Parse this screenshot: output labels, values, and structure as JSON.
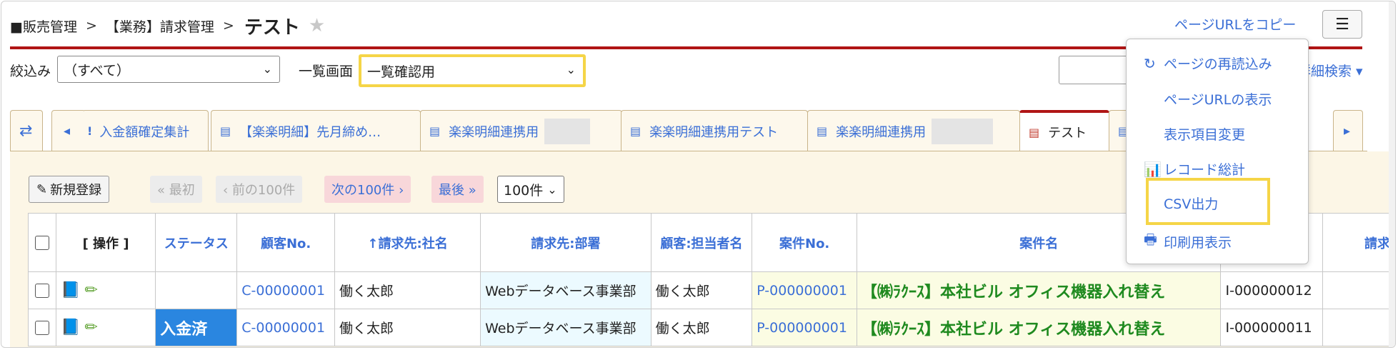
{
  "breadcrumb": {
    "root": "■販売管理",
    "sep": ">",
    "parent": "【業務】請求管理",
    "current": "テスト"
  },
  "header": {
    "copy_url": "ページURLをコピー"
  },
  "filter": {
    "label": "絞込み",
    "value": "（すべて）"
  },
  "listview": {
    "label": "一覧画面",
    "value": "一覧確認用"
  },
  "adv_search": "詳細検索 ▾",
  "tabs": [
    {
      "label": "入金額確定集計"
    },
    {
      "label": "【楽楽明細】先月締め…"
    },
    {
      "label": "楽楽明細連携用"
    },
    {
      "label": "楽楽明細連携用テスト"
    },
    {
      "label": "楽楽明細連携用"
    },
    {
      "label": "テスト"
    }
  ],
  "toolbar": {
    "new": "新規登録",
    "first": "« 最初",
    "prev": "‹ 前の100件",
    "next": "次の100件 ›",
    "last": "最後 »",
    "per_page": "100件"
  },
  "table": {
    "headers": {
      "op": "[ 操作 ]",
      "status": "ステータス",
      "customer_no": "顧客No.",
      "company": "↑請求先:社名",
      "dept": "請求先:部署",
      "contact": "顧客:担当者名",
      "case_no": "案件No.",
      "case_name": "案件名",
      "inv": "",
      "last": "請求"
    },
    "rows": [
      {
        "status": "",
        "customer_no": "C-00000001",
        "company": "働く太郎",
        "dept": "Webデータベース事業部",
        "contact": "働く太郎",
        "case_no": "P-000000001",
        "case_name": "【㈱ﾗｸｰｽ】本社ビル オフィス機器入れ替え",
        "inv": "I-000000012"
      },
      {
        "status": "入金済",
        "customer_no": "C-00000001",
        "company": "働く太郎",
        "dept": "Webデータベース事業部",
        "contact": "働く太郎",
        "case_no": "P-000000001",
        "case_name": "【㈱ﾗｸｰｽ】本社ビル オフィス機器入れ替え",
        "inv": "I-000000011"
      }
    ]
  },
  "menu": {
    "reload": "ページの再読込み",
    "show_url": "ページURLの表示",
    "columns": "表示項目変更",
    "stats": "レコード総計",
    "csv": "CSV出力",
    "print": "印刷用表示"
  }
}
